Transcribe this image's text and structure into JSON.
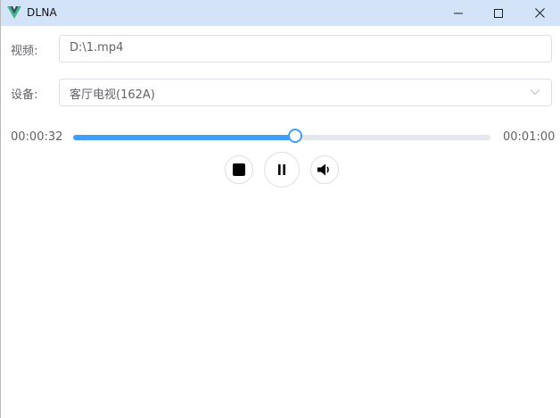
{
  "window": {
    "title": "DLNA",
    "app_icon": "vue-logo-icon",
    "titlebar_color": "#d3e3f8",
    "controls": [
      "minimize-icon",
      "maximize-icon",
      "close-icon"
    ]
  },
  "form": {
    "video_label": "视频:",
    "video_value": "D:\\1.mp4",
    "device_label": "设备:",
    "device_value": "客厅电视(162A)"
  },
  "player": {
    "current_time": "00:00:32",
    "total_time": "00:01:00",
    "progress": 0.533,
    "accent_color": "#409eff",
    "buttons": [
      "stop-icon",
      "pause-icon",
      "volume-icon"
    ]
  }
}
